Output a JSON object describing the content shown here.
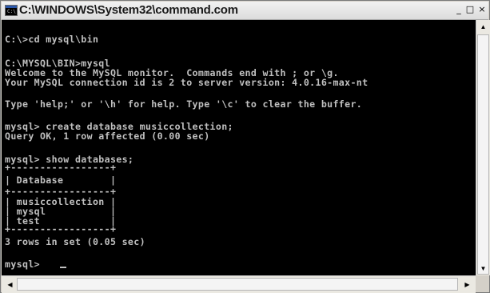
{
  "window": {
    "title": "C:\\WINDOWS\\System32\\command.com",
    "icon_label": "C:\\",
    "minimize_glyph": "_",
    "maximize_glyph": "□",
    "close_glyph": "×"
  },
  "console": {
    "lines": [
      "C:\\>cd mysql\\bin",
      "C:\\MYSQL\\BIN>mysql",
      "Welcome to the MySQL monitor.  Commands end with ; or \\g.",
      "Your MySQL connection id is 2 to server version: 4.0.16-max-nt",
      "Type 'help;' or '\\h' for help. Type '\\c' to clear the buffer.",
      "mysql> create database musiccollection;",
      "Query OK, 1 row affected (0.00 sec)",
      "mysql> show databases;",
      "+-----------------+",
      "| Database        |",
      "+-----------------+",
      "| musiccollection |",
      "| mysql           |",
      "| test            |",
      "+-----------------+",
      "3 rows in set (0.05 sec)",
      "mysql> "
    ]
  },
  "scrollbars": {
    "up_icon": "up-arrow-icon",
    "down_icon": "down-arrow-icon",
    "left_icon": "left-arrow-icon",
    "right_icon": "right-arrow-icon"
  }
}
